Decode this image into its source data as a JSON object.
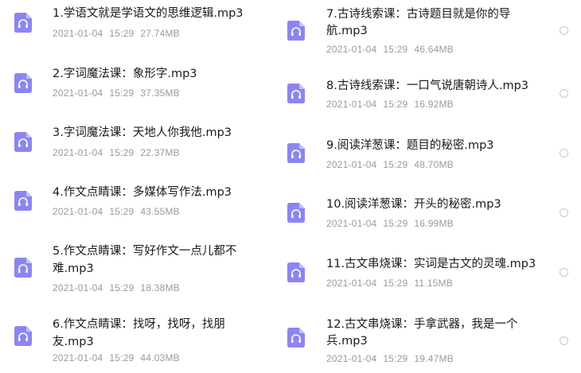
{
  "files": [
    {
      "name": "1.学语文就是学语文的思维逻辑.mp3",
      "lines": [
        "1.学语文就是学语文的思维逻辑.mp3"
      ],
      "date": "2021-01-04",
      "time": "15:29",
      "size": "27.74MB"
    },
    {
      "name": "2.字词魔法课：象形字.mp3",
      "lines": [
        "2.字词魔法课：象形字.mp3"
      ],
      "date": "2021-01-04",
      "time": "15:29",
      "size": "37.35MB"
    },
    {
      "name": "3.字词魔法课：天地人你我他.mp3",
      "lines": [
        "3.字词魔法课：天地人你我他.mp3"
      ],
      "date": "2021-01-04",
      "time": "15:29",
      "size": "22.37MB"
    },
    {
      "name": "4.作文点睛课：多媒体写作法.mp3",
      "lines": [
        "4.作文点睛课：多媒体写作法.mp3"
      ],
      "date": "2021-01-04",
      "time": "15:29",
      "size": "43.55MB"
    },
    {
      "name": "5.作文点睛课：写好作文一点儿都不难.mp3",
      "lines": [
        "5.作文点睛课：写好作文一点儿都不",
        "难.mp3"
      ],
      "date": "2021-01-04",
      "time": "15:29",
      "size": "18.38MB"
    },
    {
      "name": "6.作文点睛课：找呀，找呀，找朋友.mp3",
      "lines": [
        "6.作文点睛课：找呀，找呀，找朋",
        "友.mp3"
      ],
      "date": "2021-01-04",
      "time": "15:29",
      "size": "44.03MB"
    },
    {
      "name": "7.古诗线索课：古诗题目就是你的导航.mp3",
      "lines": [
        "7.古诗线索课：古诗题目就是你的导",
        "航.mp3"
      ],
      "date": "2021-01-04",
      "time": "15:29",
      "size": "46.64MB"
    },
    {
      "name": "8.古诗线索课：一口气说唐朝诗人.mp3",
      "lines": [
        "8.古诗线索课：一口气说唐朝诗人.mp3"
      ],
      "date": "2021-01-04",
      "time": "15:29",
      "size": "16.92MB"
    },
    {
      "name": "9.阅读洋葱课：题目的秘密.mp3",
      "lines": [
        "9.阅读洋葱课：题目的秘密.mp3"
      ],
      "date": "2021-01-04",
      "time": "15:29",
      "size": "48.70MB"
    },
    {
      "name": "10.阅读洋葱课：开头的秘密.mp3",
      "lines": [
        "10.阅读洋葱课：开头的秘密.mp3"
      ],
      "date": "2021-01-04",
      "time": "15:29",
      "size": "16.99MB"
    },
    {
      "name": "11.古文串烧课：实词是古文的灵魂.mp3",
      "lines": [
        "11.古文串烧课：实词是古文的灵魂.mp3"
      ],
      "date": "2021-01-04",
      "time": "15:29",
      "size": "11.15MB"
    },
    {
      "name": "12.古文串烧课：手拿武器，我是一个兵.mp3",
      "lines": [
        "12.古文串烧课：手拿武器，我是一个",
        "兵.mp3"
      ],
      "date": "2021-01-04",
      "time": "15:29",
      "size": "19.47MB"
    }
  ],
  "icon": "audio-file-icon",
  "colors": {
    "icon_fill": "#8c85f0",
    "icon_fold": "#c3bef8",
    "meta_text": "#9a9a9a"
  }
}
